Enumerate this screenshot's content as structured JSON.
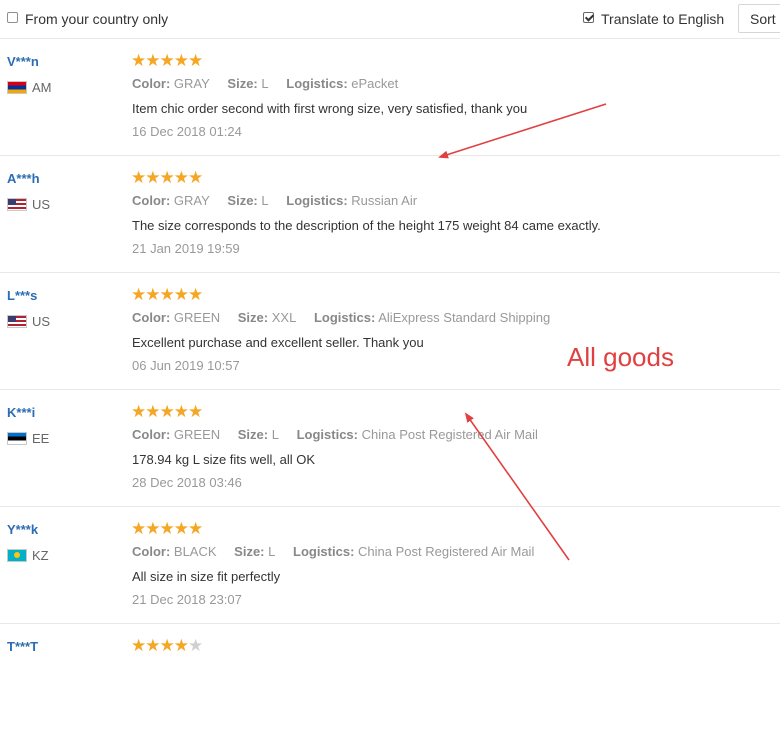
{
  "filters": {
    "country_only_label": "From your country only",
    "country_only_checked": false,
    "translate_label": "Translate to English",
    "translate_checked": true,
    "sort_label": "Sort by"
  },
  "meta_labels": {
    "color": "Color:",
    "size": "Size:",
    "logistics": "Logistics:"
  },
  "reviews": [
    {
      "user": "V***n",
      "country": "AM",
      "rating": 5,
      "color": "GRAY",
      "size": "L",
      "logistics": "ePacket",
      "text": "Item chic order second with first wrong size, very satisfied, thank you",
      "date": "16 Dec 2018 01:24"
    },
    {
      "user": "A***h",
      "country": "US",
      "rating": 5,
      "color": "GRAY",
      "size": "L",
      "logistics": "Russian Air",
      "text": "The size corresponds to the description of the height 175 weight 84 came exactly.",
      "date": "21 Jan 2019 19:59"
    },
    {
      "user": "L***s",
      "country": "US",
      "rating": 5,
      "color": "GREEN",
      "size": "XXL",
      "logistics": "AliExpress Standard Shipping",
      "text": "Excellent purchase and excellent seller. Thank you",
      "date": "06 Jun 2019 10:57"
    },
    {
      "user": "K***i",
      "country": "EE",
      "rating": 5,
      "color": "GREEN",
      "size": "L",
      "logistics": "China Post Registered Air Mail",
      "text": "178.94 kg L size fits well, all OK",
      "date": "28 Dec 2018 03:46"
    },
    {
      "user": "Y***k",
      "country": "KZ",
      "rating": 5,
      "color": "BLACK",
      "size": "L",
      "logistics": "China Post Registered Air Mail",
      "text": "All size in size fit perfectly",
      "date": "21 Dec 2018 23:07"
    },
    {
      "user": "T***T",
      "country": "",
      "rating": 4,
      "color": "",
      "size": "",
      "logistics": "",
      "text": "",
      "date": ""
    }
  ],
  "annotation": {
    "text": "All goods",
    "color": "#e04040"
  },
  "colors": {
    "star": "#f5a623",
    "username": "#2b6cb3",
    "annotation_red": "#e04040"
  }
}
